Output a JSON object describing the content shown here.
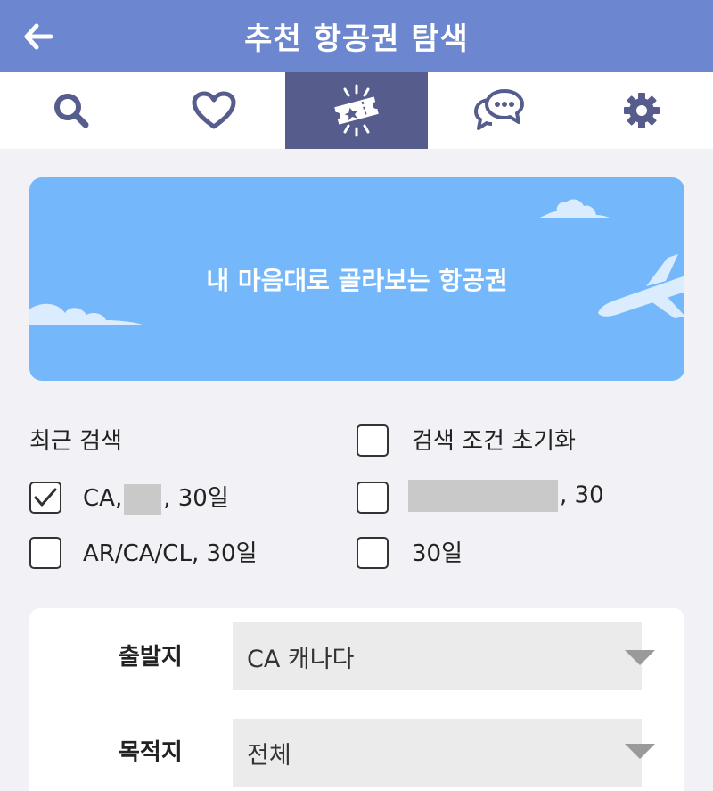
{
  "header": {
    "title": "추천 항공권 탐색",
    "back_icon": "arrow-left-icon",
    "bg_color": "#6c86cf"
  },
  "tabs": [
    {
      "icon": "search-icon",
      "active": false
    },
    {
      "icon": "heart-icon",
      "active": false
    },
    {
      "icon": "ticket-icon",
      "active": true
    },
    {
      "icon": "chat-bubbles-icon",
      "active": false
    },
    {
      "icon": "gear-icon",
      "active": false
    }
  ],
  "banner": {
    "text": "내 마음대로 골라보는 항공권",
    "bg_color": "#74b8fb"
  },
  "recent": {
    "title": "최근 검색",
    "reset_label": "검색 조건 초기화",
    "items": [
      {
        "prefix": "CA,",
        "suffix": ", 30일",
        "checked": true
      },
      {
        "prefix": "",
        "suffix": ", 30",
        "checked": false
      },
      {
        "prefix": "AR/CA/CL, 30일",
        "suffix": "",
        "checked": false
      },
      {
        "prefix": "30일",
        "suffix": "",
        "checked": false
      }
    ]
  },
  "form": {
    "departure_label": "출발지",
    "departure_value": "CA 캐나다",
    "destination_label": "목적지",
    "destination_value": "전체"
  }
}
